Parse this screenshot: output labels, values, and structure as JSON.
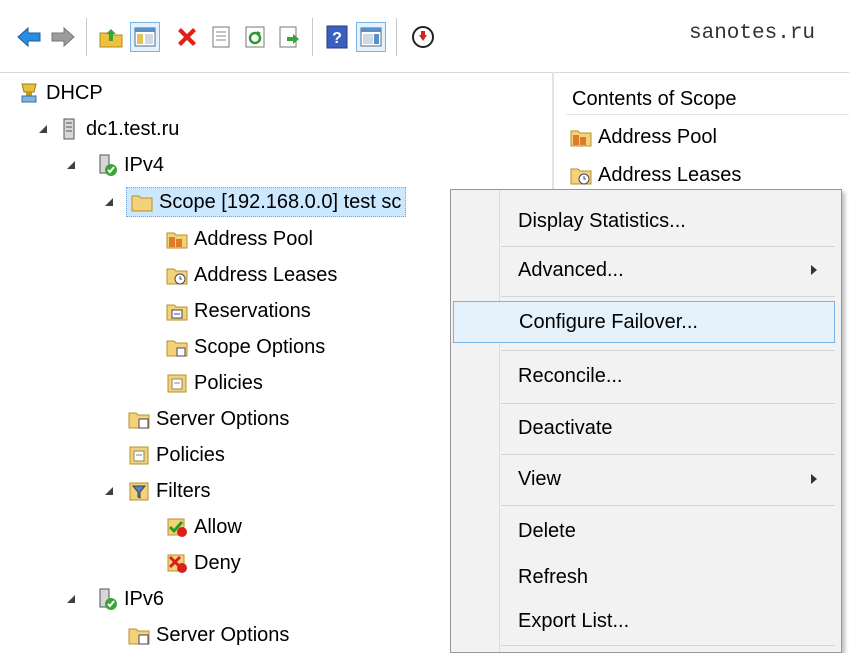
{
  "toolbar": {
    "buttons": [
      "back-icon",
      "forward-icon",
      "up-folder-icon",
      "show-hide-tree-icon",
      "delete-icon",
      "properties-icon",
      "refresh-icon",
      "export-list-icon",
      "help-icon",
      "show-hide-action-pane-icon",
      "download-icon"
    ],
    "watermark": "sanotes.ru"
  },
  "tree": {
    "root": "DHCP",
    "server": "dc1.test.ru",
    "ipv4": "IPv4",
    "scope": "Scope [192.168.0.0] test sc",
    "address_pool": "Address Pool",
    "address_leases": "Address Leases",
    "reservations": "Reservations",
    "scope_options": "Scope Options",
    "scope_policies": "Policies",
    "server_options": "Server Options",
    "policies": "Policies",
    "filters": "Filters",
    "allow": "Allow",
    "deny": "Deny",
    "ipv6": "IPv6",
    "ipv6_server_options": "Server Options"
  },
  "right_pane": {
    "header": "Contents of Scope",
    "items": [
      "Address Pool",
      "Address Leases"
    ]
  },
  "context_menu": {
    "display_statistics": "Display Statistics...",
    "advanced": "Advanced...",
    "configure_failover": "Configure Failover...",
    "reconcile": "Reconcile...",
    "deactivate": "Deactivate",
    "view": "View",
    "delete": "Delete",
    "refresh": "Refresh",
    "export_list": "Export List..."
  },
  "colors": {
    "selection": "#cce8ff",
    "menu_bg": "#f2f2f2",
    "highlight": "#e5f1fb",
    "accent": "#2a7ae2"
  }
}
